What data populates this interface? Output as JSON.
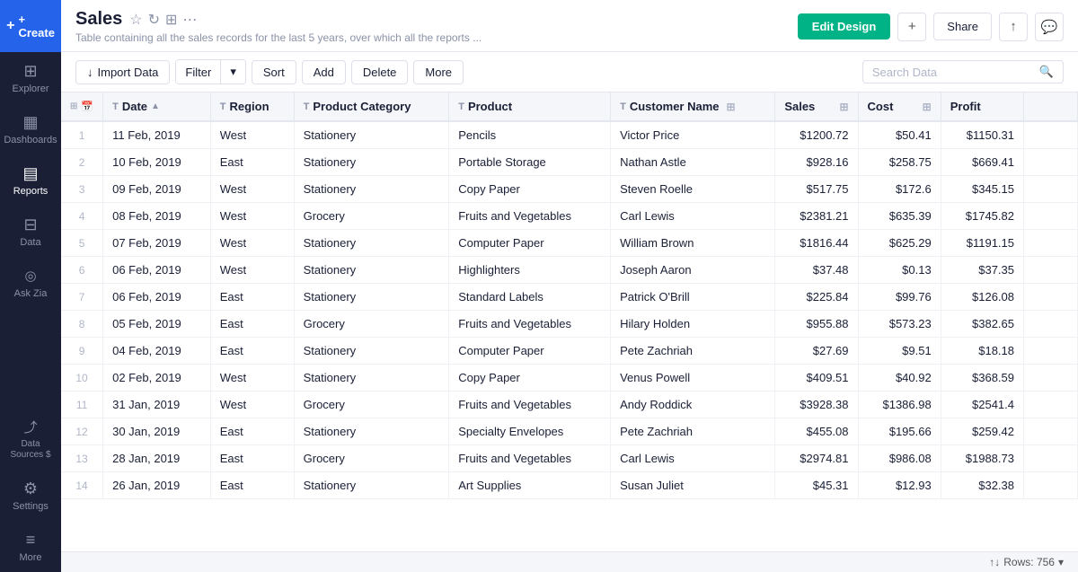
{
  "sidebar": {
    "create_label": "+ Create",
    "items": [
      {
        "id": "explorer",
        "label": "Explorer",
        "icon": "⊞"
      },
      {
        "id": "dashboards",
        "label": "Dashboards",
        "icon": "▦"
      },
      {
        "id": "reports",
        "label": "Reports",
        "icon": "▤",
        "active": true
      },
      {
        "id": "data",
        "label": "Data",
        "icon": "⊟"
      },
      {
        "id": "ask-zia",
        "label": "Ask Zia",
        "icon": "◎"
      },
      {
        "id": "data-sources",
        "label": "Data Sources $",
        "icon": "⤴"
      },
      {
        "id": "settings",
        "label": "Settings",
        "icon": "⚙"
      },
      {
        "id": "more",
        "label": "More",
        "icon": "≡"
      }
    ]
  },
  "topbar": {
    "title": "Sales",
    "subtitle": "Table containing all the sales records for the last 5 years, over which all the reports ...",
    "buttons": {
      "edit_design": "Edit Design",
      "share": "Share"
    }
  },
  "toolbar": {
    "import_data": "Import Data",
    "filter": "Filter",
    "sort": "Sort",
    "add": "Add",
    "delete": "Delete",
    "more": "More",
    "search_placeholder": "Search Data"
  },
  "table": {
    "columns": [
      {
        "id": "date",
        "label": "Date",
        "type": "T",
        "has_sort": true
      },
      {
        "id": "region",
        "label": "Region",
        "type": "T"
      },
      {
        "id": "product_category",
        "label": "Product Category",
        "type": "T"
      },
      {
        "id": "product",
        "label": "Product",
        "type": "T"
      },
      {
        "id": "customer_name",
        "label": "Customer Name",
        "type": "T",
        "has_icon": true
      },
      {
        "id": "sales",
        "label": "Sales",
        "type": "num",
        "has_icon": true
      },
      {
        "id": "cost",
        "label": "Cost",
        "type": "num",
        "has_icon": true
      },
      {
        "id": "profit",
        "label": "Profit",
        "type": "num"
      }
    ],
    "rows": [
      {
        "num": 1,
        "date": "11 Feb, 2019",
        "region": "West",
        "product_category": "Stationery",
        "product": "Pencils",
        "customer_name": "Victor Price",
        "sales": "$1200.72",
        "cost": "$50.41",
        "profit": "$1150.31"
      },
      {
        "num": 2,
        "date": "10 Feb, 2019",
        "region": "East",
        "product_category": "Stationery",
        "product": "Portable Storage",
        "customer_name": "Nathan Astle",
        "sales": "$928.16",
        "cost": "$258.75",
        "profit": "$669.41"
      },
      {
        "num": 3,
        "date": "09 Feb, 2019",
        "region": "West",
        "product_category": "Stationery",
        "product": "Copy Paper",
        "customer_name": "Steven Roelle",
        "sales": "$517.75",
        "cost": "$172.6",
        "profit": "$345.15"
      },
      {
        "num": 4,
        "date": "08 Feb, 2019",
        "region": "West",
        "product_category": "Grocery",
        "product": "Fruits and Vegetables",
        "customer_name": "Carl Lewis",
        "sales": "$2381.21",
        "cost": "$635.39",
        "profit": "$1745.82"
      },
      {
        "num": 5,
        "date": "07 Feb, 2019",
        "region": "West",
        "product_category": "Stationery",
        "product": "Computer Paper",
        "customer_name": "William Brown",
        "sales": "$1816.44",
        "cost": "$625.29",
        "profit": "$1191.15"
      },
      {
        "num": 6,
        "date": "06 Feb, 2019",
        "region": "West",
        "product_category": "Stationery",
        "product": "Highlighters",
        "customer_name": "Joseph Aaron",
        "sales": "$37.48",
        "cost": "$0.13",
        "profit": "$37.35"
      },
      {
        "num": 7,
        "date": "06 Feb, 2019",
        "region": "East",
        "product_category": "Stationery",
        "product": "Standard Labels",
        "customer_name": "Patrick O'Brill",
        "sales": "$225.84",
        "cost": "$99.76",
        "profit": "$126.08"
      },
      {
        "num": 8,
        "date": "05 Feb, 2019",
        "region": "East",
        "product_category": "Grocery",
        "product": "Fruits and Vegetables",
        "customer_name": "Hilary Holden",
        "sales": "$955.88",
        "cost": "$573.23",
        "profit": "$382.65"
      },
      {
        "num": 9,
        "date": "04 Feb, 2019",
        "region": "East",
        "product_category": "Stationery",
        "product": "Computer Paper",
        "customer_name": "Pete Zachriah",
        "sales": "$27.69",
        "cost": "$9.51",
        "profit": "$18.18"
      },
      {
        "num": 10,
        "date": "02 Feb, 2019",
        "region": "West",
        "product_category": "Stationery",
        "product": "Copy Paper",
        "customer_name": "Venus Powell",
        "sales": "$409.51",
        "cost": "$40.92",
        "profit": "$368.59"
      },
      {
        "num": 11,
        "date": "31 Jan, 2019",
        "region": "West",
        "product_category": "Grocery",
        "product": "Fruits and Vegetables",
        "customer_name": "Andy Roddick",
        "sales": "$3928.38",
        "cost": "$1386.98",
        "profit": "$2541.4"
      },
      {
        "num": 12,
        "date": "30 Jan, 2019",
        "region": "East",
        "product_category": "Stationery",
        "product": "Specialty Envelopes",
        "customer_name": "Pete Zachriah",
        "sales": "$455.08",
        "cost": "$195.66",
        "profit": "$259.42"
      },
      {
        "num": 13,
        "date": "28 Jan, 2019",
        "region": "East",
        "product_category": "Grocery",
        "product": "Fruits and Vegetables",
        "customer_name": "Carl Lewis",
        "sales": "$2974.81",
        "cost": "$986.08",
        "profit": "$1988.73"
      },
      {
        "num": 14,
        "date": "26 Jan, 2019",
        "region": "East",
        "product_category": "Stationery",
        "product": "Art Supplies",
        "customer_name": "Susan Juliet",
        "sales": "$45.31",
        "cost": "$12.93",
        "profit": "$32.38"
      }
    ],
    "rows_count": "Rows: 756"
  }
}
